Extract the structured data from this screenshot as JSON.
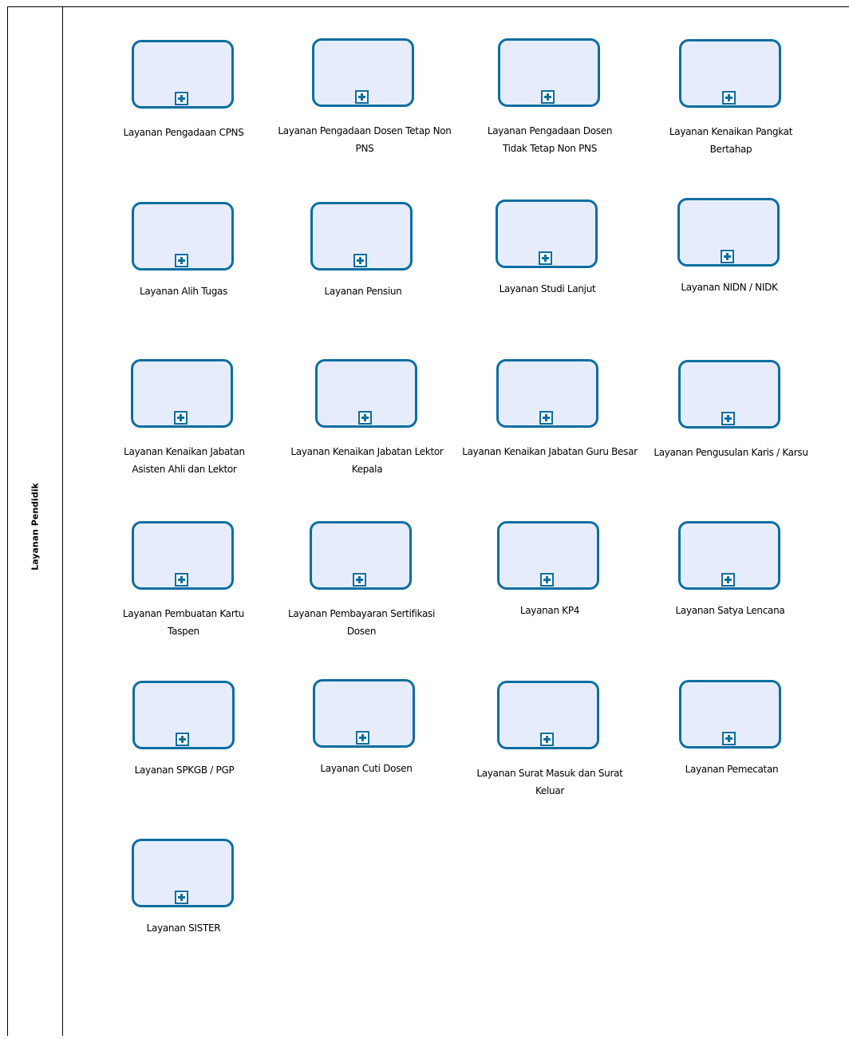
{
  "lane": {
    "label": "Layanan Pendidik"
  },
  "tasks": [
    "Layanan Pengadaan CPNS",
    "Layanan Pengadaan Dosen Tetap Non PNS",
    "Layanan Pengadaan Dosen Tidak Tetap Non PNS",
    "Layanan Kenaikan Pangkat Bertahap",
    "Layanan Alih Tugas",
    "Layanan Pensiun",
    "Layanan Studi Lanjut",
    "Layanan NIDN / NIDK",
    "Layanan Kenaikan Jabatan Asisten Ahli dan Lektor",
    "Layanan Kenaikan Jabatan Lektor Kepala",
    "Layanan Kenaikan Jabatan Guru Besar",
    "Layanan Pengusulan Karis / Karsu",
    "Layanan Pembuatan Kartu Taspen",
    "Layanan Pembayaran Sertifikasi Dosen",
    "Layanan KP4",
    "Layanan Satya Lencana",
    "Layanan SPKGB / PGP",
    "Layanan Cuti Dosen",
    "Layanan Surat Masuk dan Surat Keluar",
    "Layanan Pemecatan",
    "Layanan SISTER"
  ],
  "colors": {
    "task_border": "#0b6ea1",
    "task_fill": "#e6ecfb"
  },
  "icons": {
    "collapsed_subprocess": "plus-marker-icon"
  }
}
